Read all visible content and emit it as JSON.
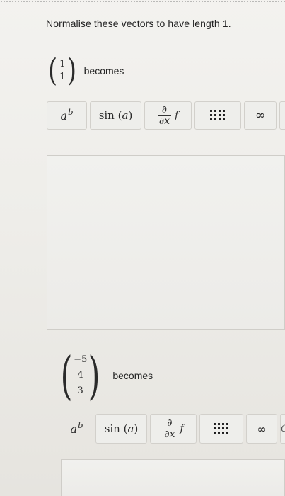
{
  "instruction": "Normalise these vectors to have length 1.",
  "questions": [
    {
      "vector": [
        "1",
        "1"
      ],
      "becomes_label": "becomes"
    },
    {
      "vector": [
        "−5",
        "4",
        "3"
      ],
      "becomes_label": "becomes"
    }
  ],
  "toolbar": {
    "power": {
      "base": "a",
      "exp": "b"
    },
    "sin": {
      "fn": "sin",
      "open": "(",
      "arg": "a",
      "close": ")"
    },
    "derivative": {
      "num": "∂",
      "den": "∂x",
      "fn": "f"
    },
    "matrix_icon": "matrix-icon",
    "infinity": "∞",
    "clipped_next": "C"
  }
}
